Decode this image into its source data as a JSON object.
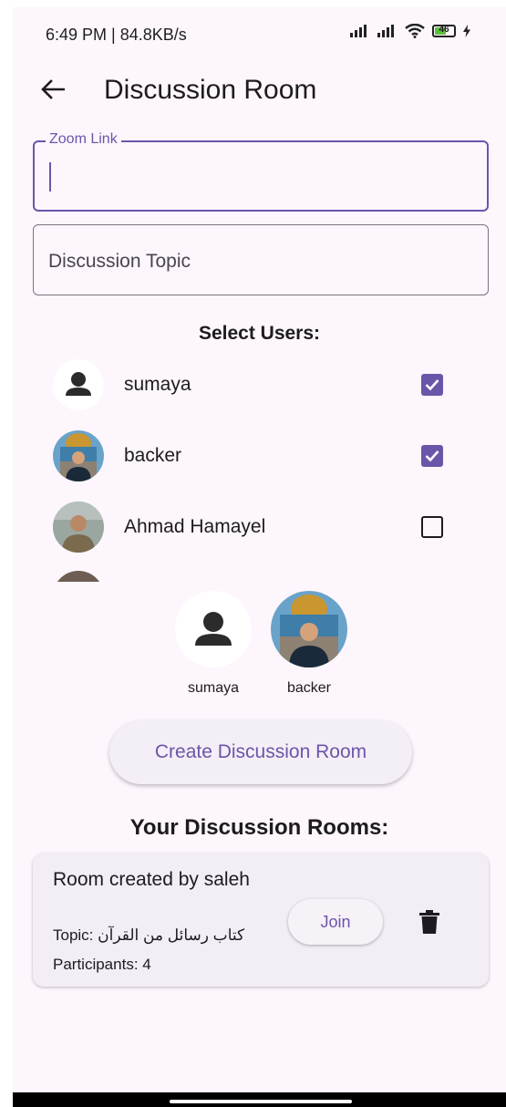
{
  "status_bar": {
    "time": "6:49 PM | 84.8KB/s",
    "battery": "46"
  },
  "app_bar": {
    "title": "Discussion Room"
  },
  "form": {
    "zoom_label": "Zoom Link",
    "zoom_value": "",
    "topic_placeholder": "Discussion Topic"
  },
  "select_users": {
    "title": "Select Users:",
    "users": [
      {
        "name": "sumaya",
        "checked": true
      },
      {
        "name": "backer",
        "checked": true
      },
      {
        "name": "Ahmad Hamayel",
        "checked": false
      }
    ]
  },
  "selected_users": [
    {
      "name": "sumaya"
    },
    {
      "name": "backer"
    }
  ],
  "create_button": "Create Discussion Room",
  "rooms": {
    "title": "Your Discussion Rooms:",
    "items": [
      {
        "title": "Room created by saleh",
        "topic": "Topic: كتاب رسائل من القرآن",
        "participants": "Participants: 4",
        "join_label": "Join"
      }
    ]
  },
  "colors": {
    "accent": "#6a56a9",
    "background": "#fdf6fd",
    "card": "#f3edf5"
  }
}
